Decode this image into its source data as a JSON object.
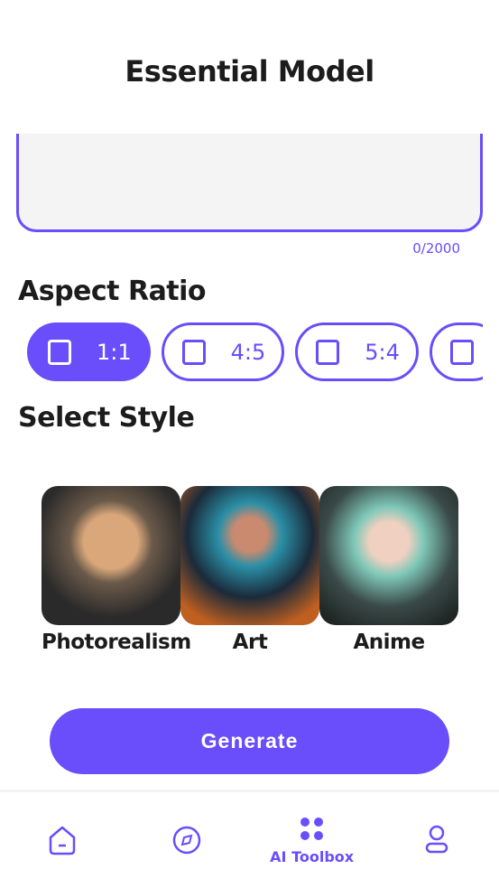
{
  "header": {
    "title": "Essential Model"
  },
  "prompt": {
    "value": "",
    "counter": "0/2000"
  },
  "aspect": {
    "heading": "Aspect Ratio",
    "options": [
      {
        "label": "1:1",
        "selected": true
      },
      {
        "label": "4:5",
        "selected": false
      },
      {
        "label": "5:4",
        "selected": false
      },
      {
        "label": "",
        "selected": false
      }
    ]
  },
  "style": {
    "heading": "Select Style",
    "options": [
      {
        "label": "Photorealism"
      },
      {
        "label": "Art"
      },
      {
        "label": "Anime"
      }
    ]
  },
  "generate": {
    "label": "Generate"
  },
  "nav": {
    "items": [
      {
        "icon": "home-icon",
        "label": ""
      },
      {
        "icon": "compass-icon",
        "label": ""
      },
      {
        "icon": "grid-dots-icon",
        "label": "AI Toolbox",
        "active": true
      },
      {
        "icon": "user-icon",
        "label": ""
      }
    ]
  },
  "colors": {
    "accent": "#6a4dfb"
  }
}
